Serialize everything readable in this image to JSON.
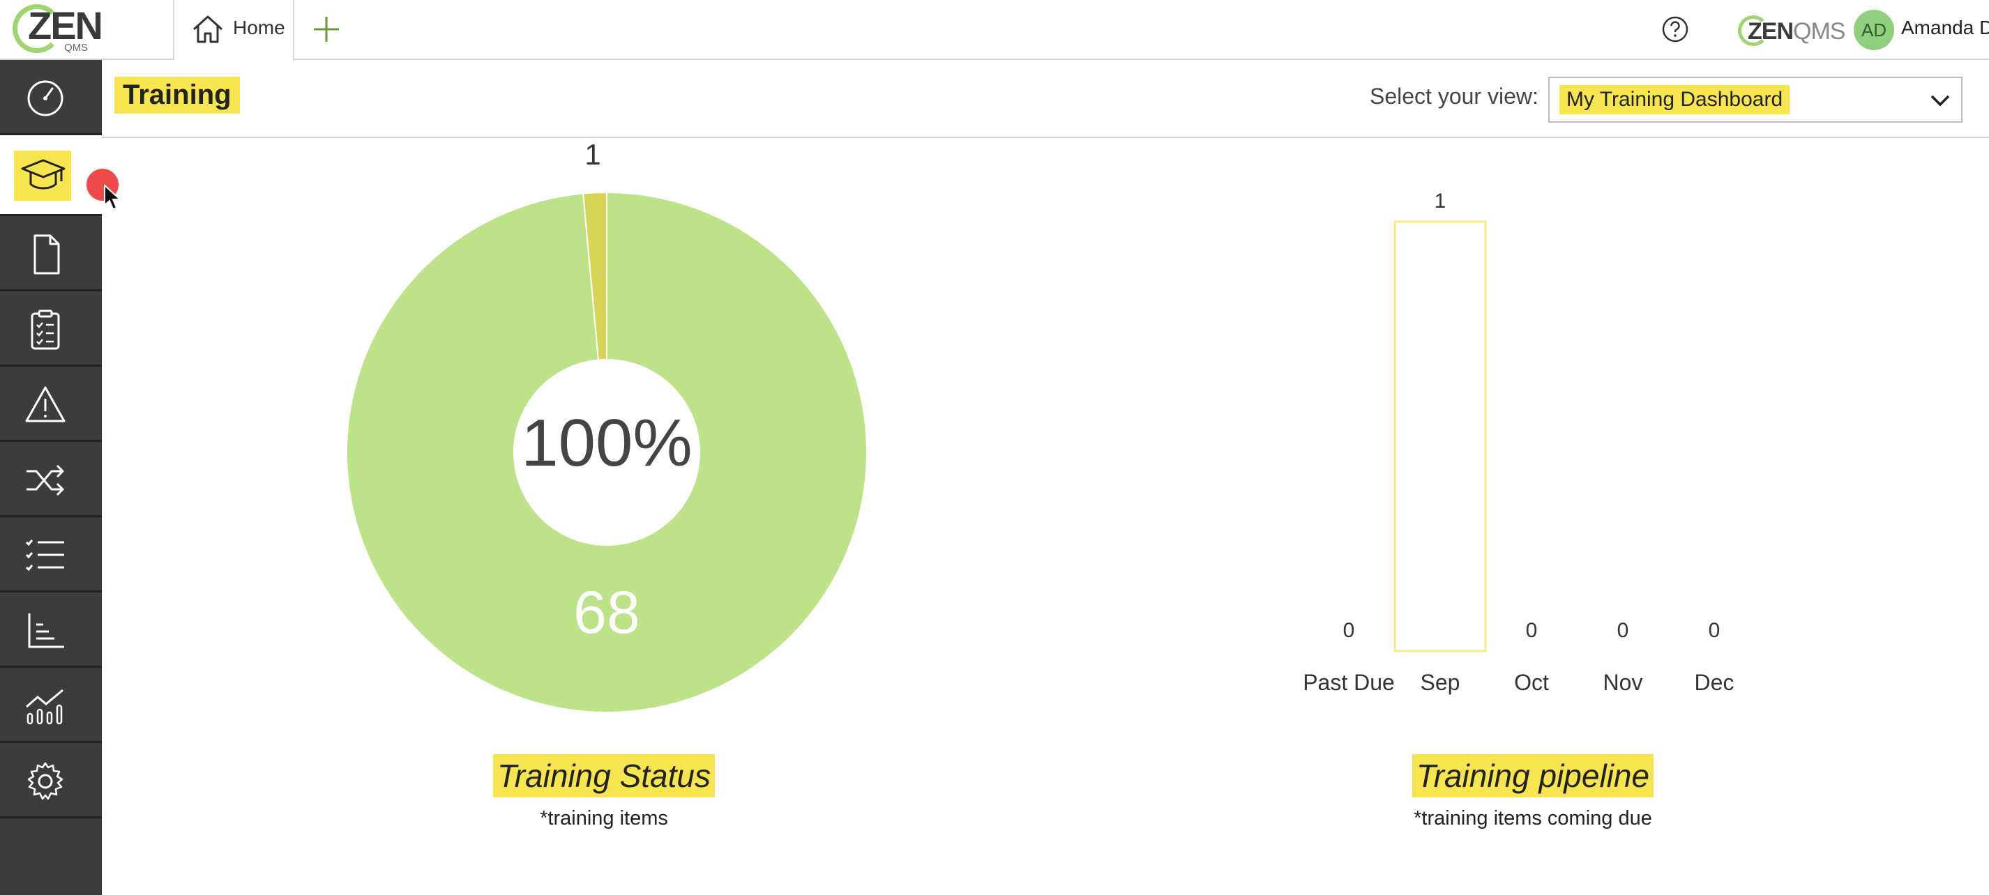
{
  "app": {
    "logo_text": "ZEN",
    "logo_sub": "QMS"
  },
  "tabs": [
    {
      "label": "Home"
    }
  ],
  "header": {
    "brand": "ZENQMS",
    "brand_part1": "ZEN",
    "brand_part2": "QMS",
    "user_initials": "AD",
    "user_name": "Amanda D"
  },
  "sidebar": {
    "items": [
      {
        "icon": "dashboard-gauge-icon"
      },
      {
        "icon": "graduation-cap-icon",
        "active": true
      },
      {
        "icon": "document-icon"
      },
      {
        "icon": "clipboard-checklist-icon"
      },
      {
        "icon": "warning-triangle-icon"
      },
      {
        "icon": "shuffle-icon"
      },
      {
        "icon": "checklist-icon"
      },
      {
        "icon": "bar-chart-icon"
      },
      {
        "icon": "analytics-icon"
      },
      {
        "icon": "gear-icon"
      }
    ]
  },
  "page": {
    "title": "Training",
    "view_label": "Select your view:",
    "view_value": "My Training Dashboard"
  },
  "colors": {
    "highlight": "#f7e550",
    "green": "#bce388",
    "yellow_slice": "#d8d456",
    "bar_outline": "#f3ec8a",
    "sidebar": "#3c3c3c"
  },
  "chart_data": [
    {
      "type": "pie",
      "title": "Training Status",
      "subtitle": "*training items",
      "center_label": "100%",
      "slices": [
        {
          "value": 68,
          "color": "#bce388",
          "label": "68"
        },
        {
          "value": 1,
          "color": "#d8d456",
          "label": "1"
        }
      ]
    },
    {
      "type": "bar",
      "title": "Training pipeline",
      "subtitle": "*training items coming due",
      "categories": [
        "Past Due",
        "Sep",
        "Oct",
        "Nov",
        "Dec"
      ],
      "values": [
        0,
        1,
        0,
        0,
        0
      ],
      "ylim": [
        0,
        1
      ]
    }
  ]
}
